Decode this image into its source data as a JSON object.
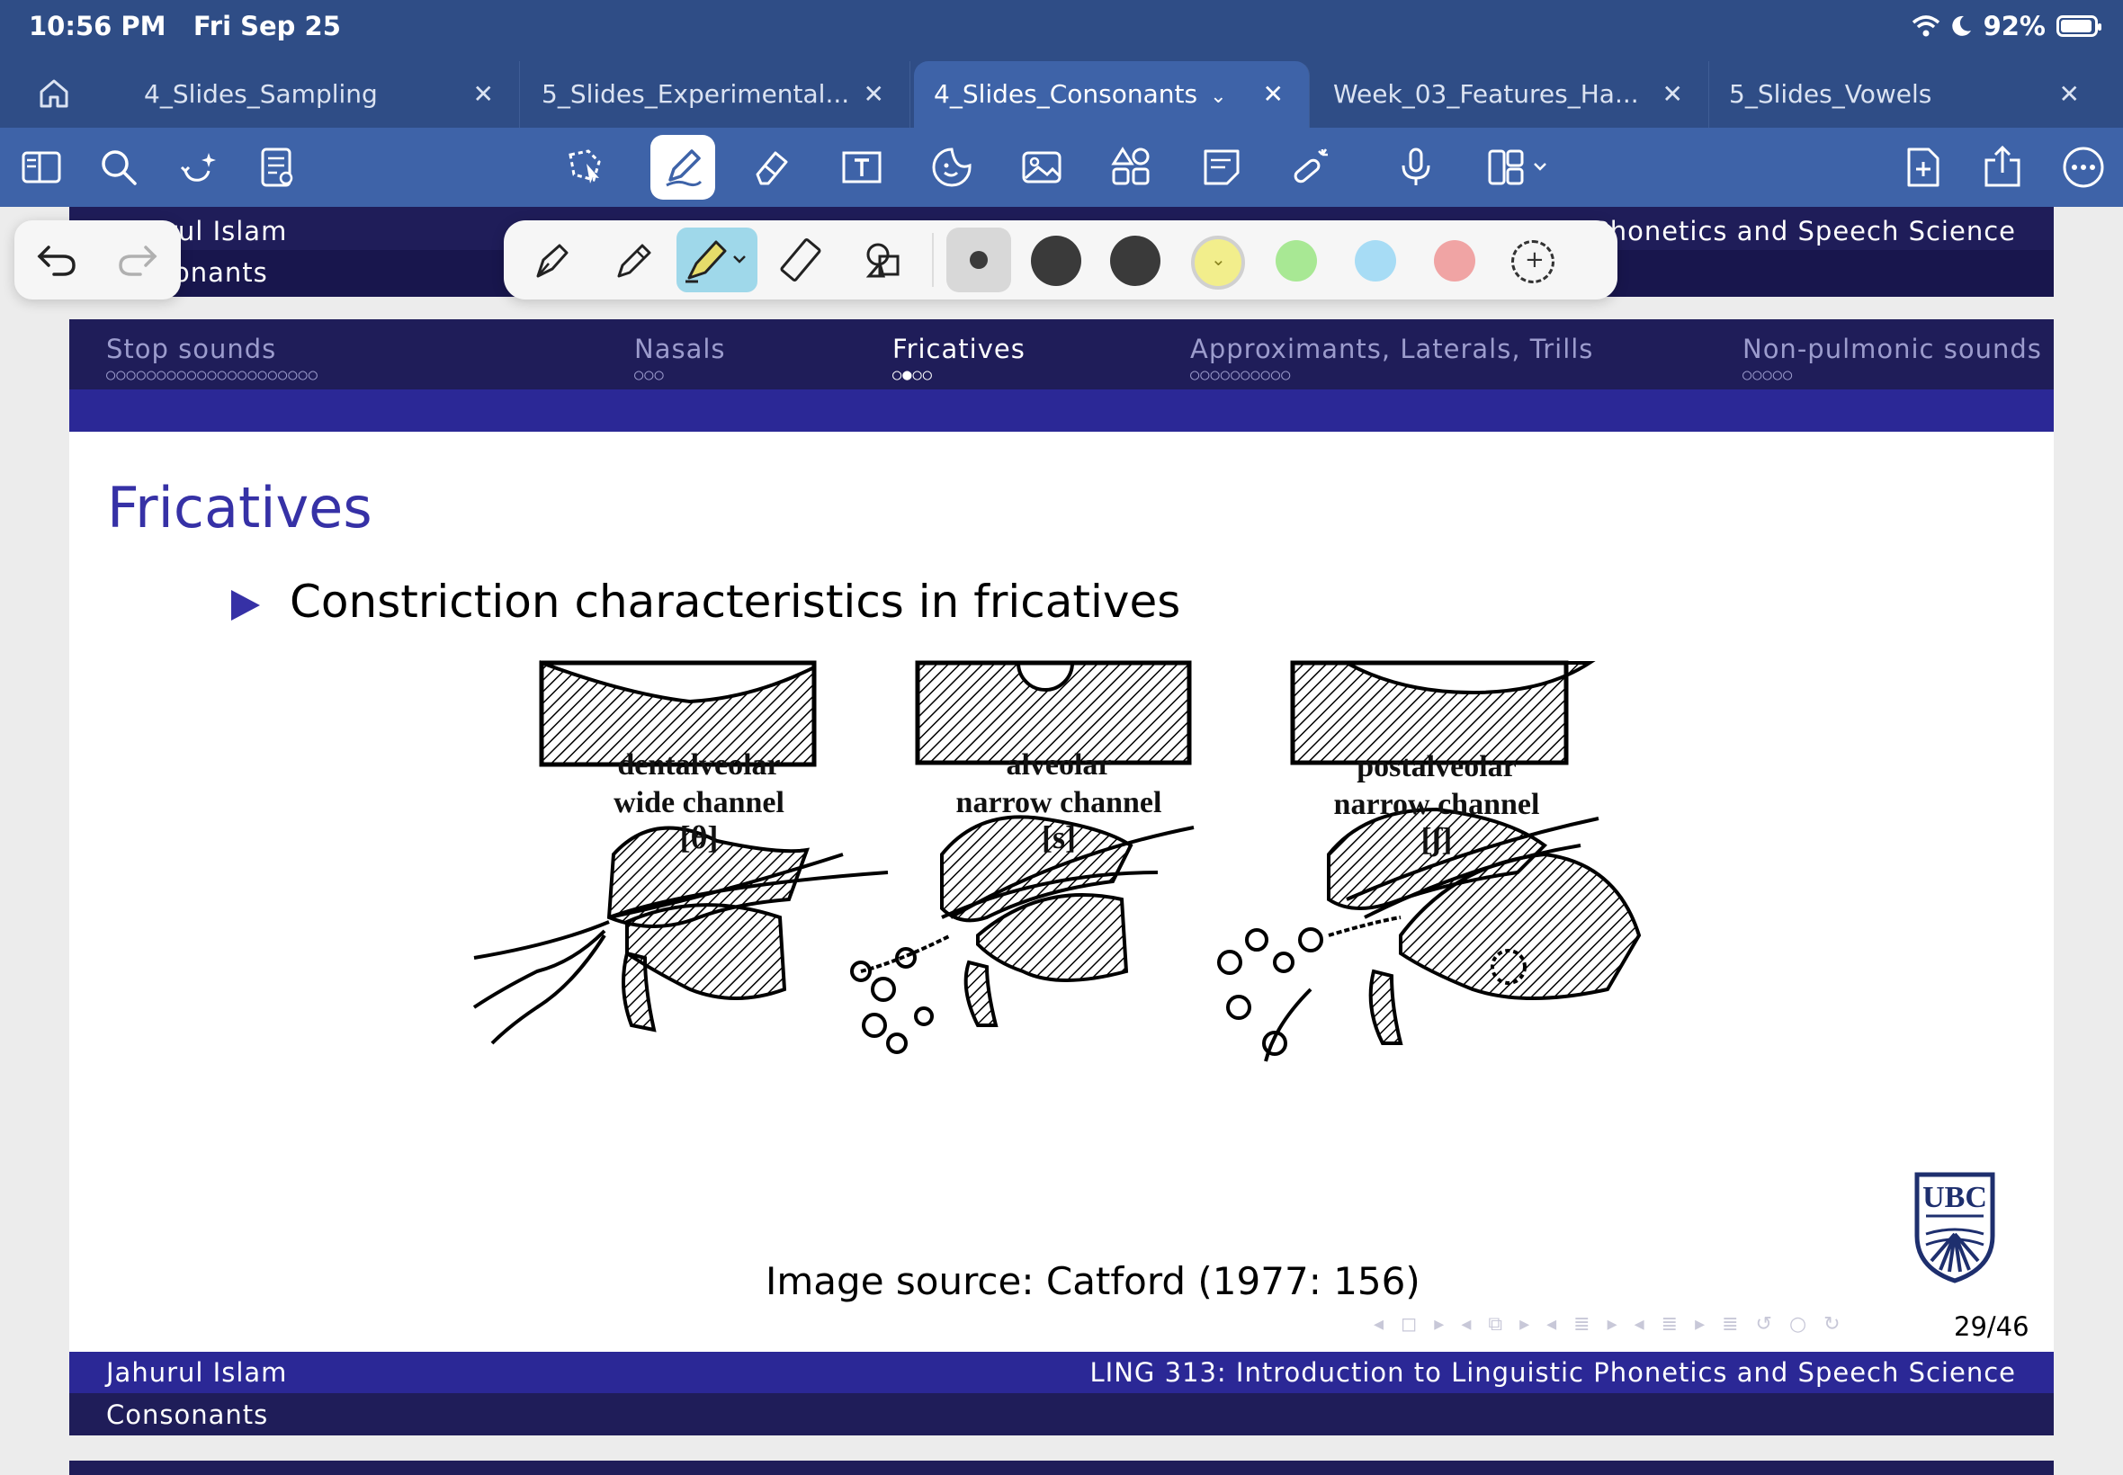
{
  "status": {
    "time": "10:56 PM",
    "date": "Fri Sep 25",
    "battery": "92%"
  },
  "tabs": [
    {
      "label": "4_Slides_Sampling"
    },
    {
      "label": "5_Slides_Experimental..."
    },
    {
      "label": "4_Slides_Consonants",
      "active": true
    },
    {
      "label": "Week_03_Features_Ha..."
    },
    {
      "label": "5_Slides_Vowels"
    }
  ],
  "toolbar": {
    "left_icons": [
      "sidebar-icon",
      "search-icon",
      "ai-sparkle-icon",
      "document-list-icon"
    ],
    "center_icons": [
      "lasso-icon",
      "pen-icon",
      "eraser-icon",
      "text-box-icon",
      "sticker-icon",
      "image-icon",
      "shapes-icon",
      "sticky-note-icon",
      "laser-pointer-icon",
      "microphone-icon",
      "page-layout-icon"
    ],
    "right_icons": [
      "add-page-icon",
      "share-icon",
      "more-icon"
    ]
  },
  "pen_palette": {
    "tools": [
      "fountain-pen-icon",
      "ball-pen-icon",
      "highlighter-icon",
      "ruler-icon",
      "shapes-icon"
    ],
    "selected_tool": "highlighter-icon",
    "colors": [
      "#3a3a3a",
      "#3a3a3a",
      "#3a3a3a",
      "#f2ee8c",
      "#a8e894",
      "#a7dcf5",
      "#f0a4a4"
    ],
    "selected_color": "#f2ee8c"
  },
  "slide_header": {
    "author": "Jahurul Islam",
    "author_visible": "rul Islam",
    "topic": "Consonants",
    "topic_visible": "onants",
    "course_visible": "Phonetics and Speech Science"
  },
  "nav_sections": [
    {
      "label": "Stop sounds",
      "dots": "○○○○○○○○○○○○○○○○○○○○○"
    },
    {
      "label": "Nasals",
      "dots": "○○○"
    },
    {
      "label": "Fricatives",
      "dots": "○●○○",
      "current": true
    },
    {
      "label": "Approximants, Laterals, Trills",
      "dots": "○○○○○○○○○○"
    },
    {
      "label": "Non-pulmonic sounds",
      "dots": "○○○○○"
    }
  ],
  "frame": {
    "title": "Fricatives",
    "bullet": "Constriction characteristics in fricatives",
    "figures": [
      {
        "caption_1": "dentalveolar",
        "caption_2": "wide channel",
        "symbol": "[θ]"
      },
      {
        "caption_1": "alveolar",
        "caption_2": "narrow channel",
        "symbol": "[s]"
      },
      {
        "caption_1": "postalveolar",
        "caption_2": "narrow channel",
        "symbol": "[ʃ]"
      }
    ],
    "source": "Image source:  Catford (1977:  156)",
    "page": "29/46",
    "logo_text": "UBC",
    "beamer_nav": "◂ ◻ ▸ ◂ ⧉ ▸ ◂ ≣ ▸ ◂ ≣ ▸ ≣ ↺ ○ ↻"
  },
  "slide_footer": {
    "author": "Jahurul Islam",
    "course": "LING 313:  Introduction to Linguistic Phonetics and Speech Science",
    "topic": "Consonants"
  }
}
